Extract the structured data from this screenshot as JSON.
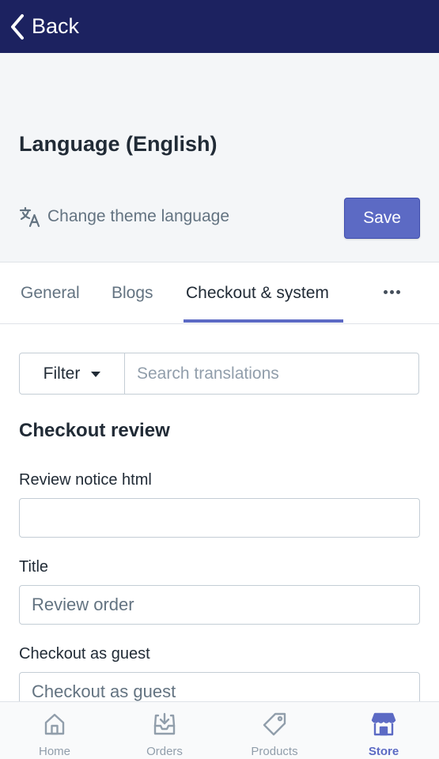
{
  "topbar": {
    "back_label": "Back"
  },
  "header": {
    "title": "Language (English)",
    "change_language": "Change theme language",
    "save_label": "Save"
  },
  "tabs": [
    {
      "label": "General",
      "active": false
    },
    {
      "label": "Blogs",
      "active": false
    },
    {
      "label": "Checkout & system",
      "active": true
    }
  ],
  "filter": {
    "label": "Filter",
    "search_placeholder": "Search translations"
  },
  "section": {
    "title": "Checkout review",
    "fields": [
      {
        "label": "Review notice html",
        "value": "",
        "placeholder": ""
      },
      {
        "label": "Title",
        "value": "",
        "placeholder": "Review order"
      },
      {
        "label": "Checkout as guest",
        "value": "",
        "placeholder": "Checkout as guest"
      }
    ]
  },
  "bottom_nav": [
    {
      "label": "Home",
      "icon": "home-icon",
      "active": false
    },
    {
      "label": "Orders",
      "icon": "orders-icon",
      "active": false
    },
    {
      "label": "Products",
      "icon": "products-icon",
      "active": false
    },
    {
      "label": "Store",
      "icon": "store-icon",
      "active": true
    }
  ],
  "colors": {
    "topbar": "#1c2260",
    "accent": "#5c6ac4",
    "header_bg": "#f4f6f8"
  }
}
